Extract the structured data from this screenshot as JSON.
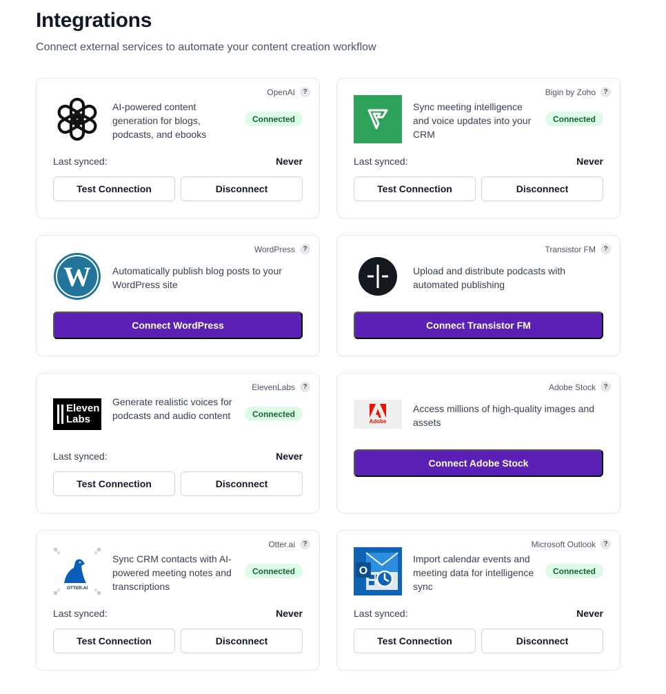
{
  "page": {
    "title": "Integrations",
    "subtitle": "Connect external services to automate your content creation workflow"
  },
  "labels": {
    "last_synced": "Last synced:",
    "test_connection": "Test Connection",
    "disconnect": "Disconnect",
    "connected": "Connected",
    "help": "?"
  },
  "integrations": [
    {
      "provider": "OpenAI",
      "description": "AI-powered content generation for blogs, podcasts, and ebooks",
      "status": "Connected",
      "last_synced": "Never",
      "icon": "openai-logo-icon"
    },
    {
      "provider": "Bigin by Zoho",
      "description": "Sync meeting intelligence and voice updates into your CRM",
      "status": "Connected",
      "last_synced": "Never",
      "icon": "bigin-logo-icon",
      "brand_color": "#2ea15a"
    },
    {
      "provider": "WordPress",
      "description": "Automatically publish blog posts to your WordPress site",
      "action": "Connect WordPress",
      "icon": "wordpress-logo-icon",
      "brand_color": "#21759b"
    },
    {
      "provider": "Transistor FM",
      "description": "Upload and distribute podcasts with automated publishing",
      "action": "Connect Transistor FM",
      "icon": "transistor-logo-icon"
    },
    {
      "provider": "ElevenLabs",
      "description": "Generate realistic voices for podcasts and audio content",
      "status": "Connected",
      "last_synced": "Never",
      "icon": "elevenlabs-logo-icon",
      "logo_text": [
        "Eleven",
        "Labs"
      ]
    },
    {
      "provider": "Adobe Stock",
      "description": "Access millions of high-quality images and assets",
      "action": "Connect Adobe Stock",
      "icon": "adobe-logo-icon",
      "logo_text": "Adobe",
      "brand_color": "#eb1000"
    },
    {
      "provider": "Otter.ai",
      "description": "Sync CRM contacts with AI-powered meeting notes and transcriptions",
      "status": "Connected",
      "last_synced": "Never",
      "icon": "otter-logo-icon",
      "logo_text": "OTTER.AI",
      "brand_color": "#0b5eb8"
    },
    {
      "provider": "Microsoft Outlook",
      "description": "Import calendar events and meeting data for intelligence sync",
      "status": "Connected",
      "last_synced": "Never",
      "icon": "outlook-logo-icon",
      "logo_text": "O",
      "brand_color": "#0f64b6"
    }
  ],
  "colors": {
    "primary_button": "#5b21b6",
    "connected_badge_bg": "#dcfce7",
    "connected_badge_text": "#166534"
  }
}
